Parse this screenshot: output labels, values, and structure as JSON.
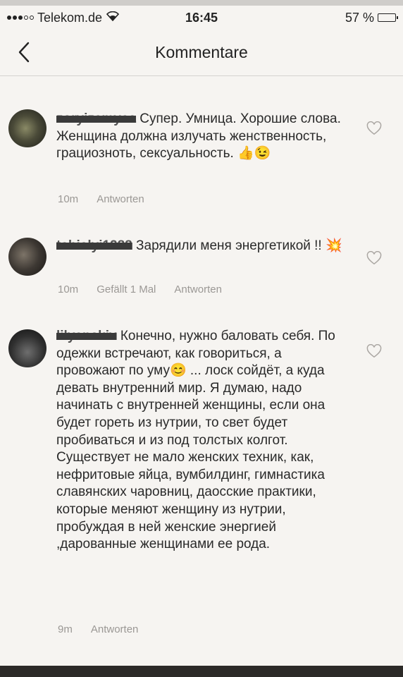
{
  "status_bar": {
    "carrier": "Telekom.de",
    "wifi_icon": "wifi-icon",
    "time": "16:45",
    "battery_percent_text": "57 %",
    "battery_level": 0.57
  },
  "nav": {
    "back_icon": "chevron-left-icon",
    "title": "Kommentare"
  },
  "comments": [
    {
      "username": "zo̷̶̶ryizamye̶a",
      "text": "Супер. Умница. Хорошие слова. Женщина должна излучать женственность, грациозноть, сексуальность.",
      "emojis": "👍😉",
      "time": "10m",
      "likes": "",
      "reply": "Antworten"
    },
    {
      "username": "tahialyi1288",
      "text": "Зарядили меня энергетикой !!",
      "emojis": "💥",
      "time": "10m",
      "likes": "Gefällt 1 Mal",
      "reply": "Antworten"
    },
    {
      "username": "lilyanakiv",
      "text_a": "Конечно, нужно баловать себя. По одежки встречают, как говориться, а провожают по уму",
      "emoji_mid": "😊",
      "text_b": "... лоск сойдёт, а куда девать внутренний мир. Я думаю, надо начинать с внутренней женщины, если она будет гореть из нутрии, то свет будет пробиваться и из под толстых колгот. Существует не мало женских техник, как, нефритовые яйца, вумбилдинг, гимнастика славянских чаровниц, даосские практики, которые меняют женщину из нутрии, пробуждая в ней женские энергией ,дарованные женщинами ее рода.",
      "time": "9m",
      "reply": "Antworten"
    }
  ],
  "heart_icon": "heart-outline-icon"
}
